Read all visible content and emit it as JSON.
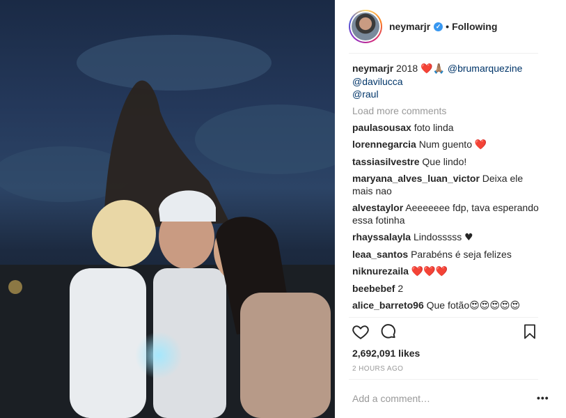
{
  "post": {
    "username": "neymarjr",
    "separator": "•",
    "follow_status": "Following",
    "caption": {
      "username": "neymarjr",
      "text": "2018 ",
      "heart": "❤️",
      "pray": "🙏🏽",
      "mentions": [
        "@brumarquezine",
        "@davilucca",
        "@raul"
      ]
    },
    "load_more": "Load more comments",
    "comments": [
      {
        "user": "paulasousax",
        "text": "foto linda"
      },
      {
        "user": "lorennegarcia",
        "text": "Num guento",
        "emoji": "❤️"
      },
      {
        "user": "tassiasilvestre",
        "text": "Que lindo!"
      },
      {
        "user": "maryana_alves_luan_victor",
        "text": "Deixa ele mais nao"
      },
      {
        "user": "alvestaylor",
        "text": "Aeeeeeee fdp, tava esperando essa fotinha"
      },
      {
        "user": "rhayssalayla",
        "text": "Lindosssss",
        "emoji": "♥"
      },
      {
        "user": "leaa_santos",
        "text": "Parabéns é seja felizes"
      },
      {
        "user": "niknurezaila",
        "text": "",
        "emoji": "❤️❤️❤️"
      },
      {
        "user": "beebebef",
        "text": "2"
      },
      {
        "user": "alice_barreto96",
        "text": "Que fotão",
        "emoji": "😍😍😍😍😍"
      }
    ],
    "likes": "2,692,091 likes",
    "time": "2 HOURS AGO",
    "add_comment_placeholder": "Add a comment…",
    "more_options": "•••",
    "icons": {
      "like": "heart-outline-icon",
      "comment": "comment-bubble-icon",
      "save": "bookmark-icon",
      "verified": "verified-badge-icon"
    },
    "colors": {
      "mention": "#003569",
      "verified": "#3897f0",
      "muted": "#999999",
      "heart": "#e0245e"
    }
  }
}
